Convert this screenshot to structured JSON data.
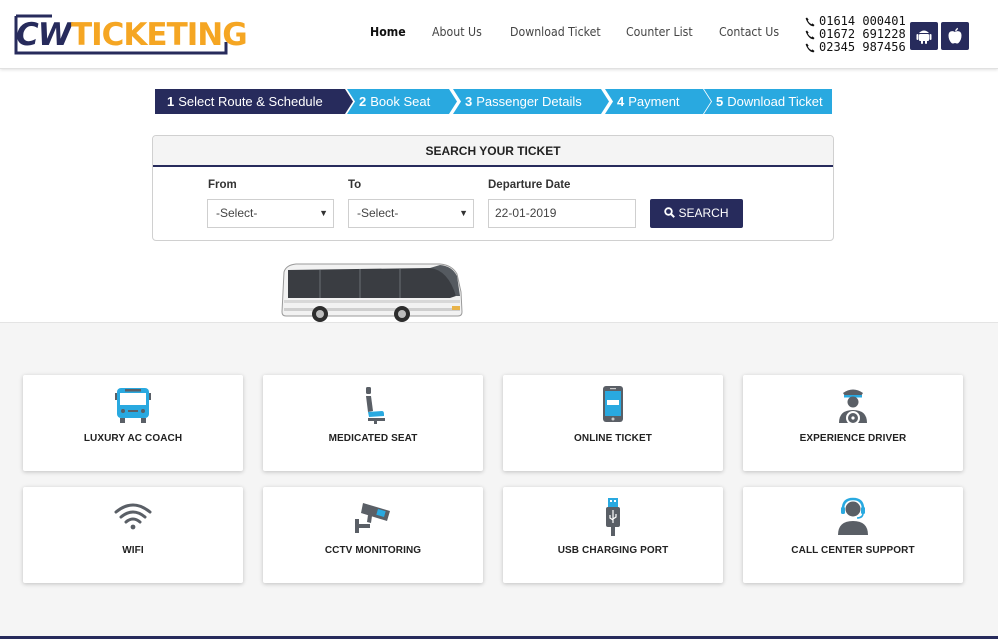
{
  "logo": {
    "part1": "CW",
    "part2": "TICKETING"
  },
  "nav": [
    {
      "label": "Home",
      "active": true
    },
    {
      "label": "About Us",
      "active": false
    },
    {
      "label": "Download Ticket",
      "active": false
    },
    {
      "label": "Counter List",
      "active": false
    },
    {
      "label": "Contact Us",
      "active": false
    }
  ],
  "phones": [
    "01614 000401",
    "01672 691228",
    "02345 987456"
  ],
  "app_buttons": [
    {
      "icon": "android-icon"
    },
    {
      "icon": "apple-icon"
    }
  ],
  "steps": [
    {
      "num": "1",
      "label": "Select Route & Schedule",
      "active": true
    },
    {
      "num": "2",
      "label": "Book Seat",
      "active": false
    },
    {
      "num": "3",
      "label": "Passenger Details",
      "active": false
    },
    {
      "num": "4",
      "label": "Payment",
      "active": false
    },
    {
      "num": "5",
      "label": "Download Ticket",
      "active": false
    }
  ],
  "search": {
    "title": "SEARCH YOUR TICKET",
    "from_label": "From",
    "from_value": "-Select-",
    "to_label": "To",
    "to_value": "-Select-",
    "date_label": "Departure Date",
    "date_value": "22-01-2019",
    "button_label": "SEARCH"
  },
  "features": [
    {
      "label": "LUXURY AC COACH",
      "icon": "bus-icon"
    },
    {
      "label": "MEDICATED SEAT",
      "icon": "seat-icon"
    },
    {
      "label": "ONLINE TICKET",
      "icon": "phone-icon"
    },
    {
      "label": "EXPERIENCE DRIVER",
      "icon": "driver-icon"
    },
    {
      "label": "WIFI",
      "icon": "wifi-icon"
    },
    {
      "label": "CCTV MONITORING",
      "icon": "cctv-icon"
    },
    {
      "label": "USB CHARGING PORT",
      "icon": "usb-icon"
    },
    {
      "label": "CALL CENTER SUPPORT",
      "icon": "headset-icon"
    }
  ],
  "colors": {
    "brand_dark": "#272b5c",
    "brand_orange": "#f5a623",
    "step_inactive": "#29a9e0",
    "icon_blue": "#29a9e0",
    "icon_gray": "#5a5f66"
  }
}
